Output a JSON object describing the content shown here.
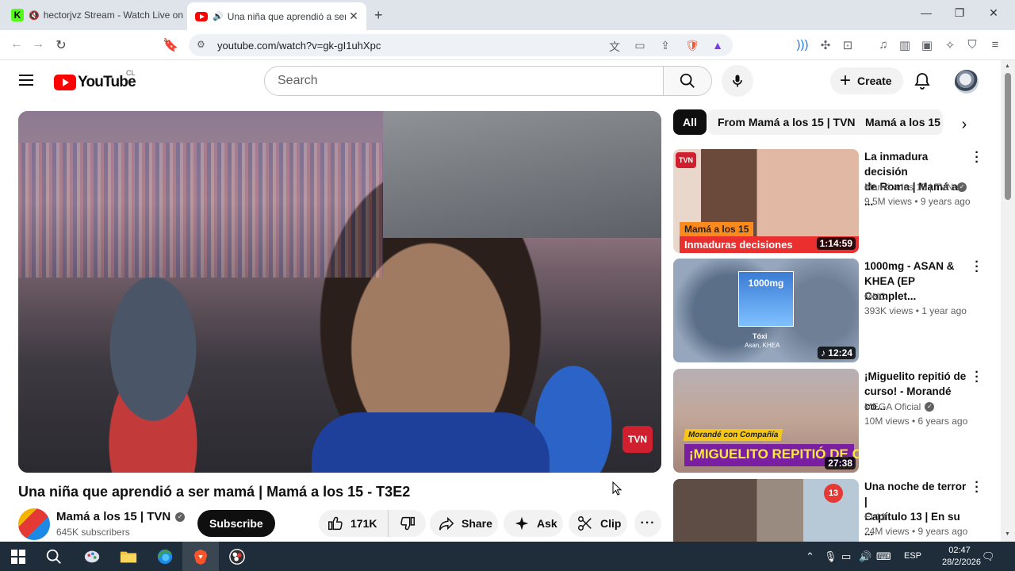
{
  "browser": {
    "tabs": [
      {
        "title": "hectorjvz Stream - Watch Live on",
        "favicon": "kick-icon",
        "muted": true
      },
      {
        "title": "Una niña que aprendió a ser m",
        "favicon": "youtube-icon",
        "audio": true
      }
    ],
    "url": "youtube.com/watch?v=gk-gI1uhXpc"
  },
  "youtube": {
    "logo_text": "YouTube",
    "country_code": "CL",
    "search_placeholder": "Search",
    "create_label": "Create"
  },
  "video": {
    "title": "Una niña que aprendió a ser mamá | Mamá a los 15 - T3E2",
    "overlay_logo": "TVN",
    "channel": {
      "name": "Mamá a los 15 | TVN",
      "subscribers": "645K subscribers",
      "verified": true
    },
    "subscribe_label": "Subscribe",
    "likes": "171K",
    "share_label": "Share",
    "ask_label": "Ask",
    "clip_label": "Clip"
  },
  "chips": [
    {
      "label": "All",
      "active": true
    },
    {
      "label": "From Mamá a los 15 | TVN",
      "active": false
    },
    {
      "label": "Mamá a los 15",
      "active": false
    }
  ],
  "recommendations": [
    {
      "title_line1": "La inmadura decisión",
      "title_line2": "de Roma | Mamá a ...",
      "channel": "Mamá a los 15 | TVN",
      "verified": true,
      "meta": "9.5M views • 9 years ago",
      "duration": "1:14:59",
      "thumb_label1": "Mamá a los 15",
      "thumb_label2": "Inmaduras decisiones",
      "thumb_logo": "TVN"
    },
    {
      "title_line1": "1000mg - ASAN &",
      "title_line2": "KHEA (EP Complet...",
      "channel": "MNC",
      "verified": false,
      "meta": "393K views • 1 year ago",
      "duration": "12:24",
      "thumb_art": "1000mg",
      "thumb_caption1": "Tóxi",
      "thumb_caption2": "Asan, KHEA"
    },
    {
      "title_line1": "¡Miguelito repitió de",
      "title_line2": "curso! - Morandé co...",
      "channel": "MEGA Oficial",
      "verified": true,
      "meta": "10M views • 6 years ago",
      "duration": "27:38",
      "thumb_label1": "Morandé con Compañía",
      "thumb_label2": "¡MIGUELITO REPITIÓ DE CURSO!"
    },
    {
      "title_line1": "Una noche de terror |",
      "title_line2": "Capítulo 13 | En su ...",
      "channel": "El 13",
      "verified": false,
      "meta": "24M views • 9 years ago",
      "thumb_logo": "13"
    }
  ],
  "taskbar": {
    "language": "ESP",
    "time": "02:47",
    "date": "28/2/2026"
  }
}
